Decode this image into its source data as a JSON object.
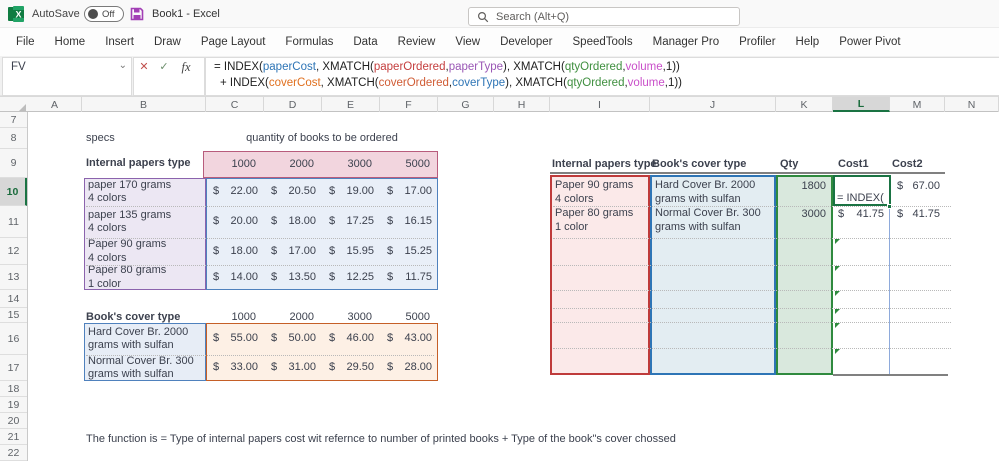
{
  "titlebar": {
    "autosave_label": "AutoSave",
    "autosave_state": "Off",
    "workbook_title": "Book1  -  Excel",
    "search_placeholder": "Search (Alt+Q)"
  },
  "ribbon_tabs": [
    "File",
    "Home",
    "Insert",
    "Draw",
    "Page Layout",
    "Formulas",
    "Data",
    "Review",
    "View",
    "Developer",
    "SpeedTools",
    "Manager Pro",
    "Profiler",
    "Help",
    "Power Pivot"
  ],
  "formula_bar": {
    "name_box": "FV",
    "cancel_label": "✕",
    "enter_label": "✓",
    "fx_label": "fx",
    "line1_segments": [
      {
        "text": "= INDEX(",
        "color": "#1f1f1f"
      },
      {
        "text": "paperCost",
        "color": "#2e75b6"
      },
      {
        "text": ", XMATCH(",
        "color": "#1f1f1f"
      },
      {
        "text": "paperOrdered",
        "color": "#c43e3e"
      },
      {
        "text": ",",
        "color": "#1f1f1f"
      },
      {
        "text": "paperType",
        "color": "#9a57b5"
      },
      {
        "text": "), XMATCH(",
        "color": "#1f1f1f"
      },
      {
        "text": "qtyOrdered",
        "color": "#3f8f3f"
      },
      {
        "text": ",",
        "color": "#1f1f1f"
      },
      {
        "text": "volume",
        "color": "#c94fc9"
      },
      {
        "text": ",1))",
        "color": "#1f1f1f"
      }
    ],
    "line2_segments": [
      {
        "text": "+ INDEX(",
        "color": "#1f1f1f"
      },
      {
        "text": "coverCost",
        "color": "#e0701f"
      },
      {
        "text": ", XMATCH(",
        "color": "#1f1f1f"
      },
      {
        "text": "coverOrdered",
        "color": "#d05c35"
      },
      {
        "text": ",",
        "color": "#1f1f1f"
      },
      {
        "text": "coverType",
        "color": "#2e75b6"
      },
      {
        "text": "), XMATCH(",
        "color": "#1f1f1f"
      },
      {
        "text": "qtyOrdered",
        "color": "#3f8f3f"
      },
      {
        "text": ",",
        "color": "#1f1f1f"
      },
      {
        "text": "volume",
        "color": "#c94fc9"
      },
      {
        "text": ",1))",
        "color": "#1f1f1f"
      }
    ]
  },
  "column_headers": [
    "A",
    "B",
    "C",
    "D",
    "E",
    "F",
    "G",
    "H",
    "I",
    "J",
    "K",
    "L",
    "M",
    "N"
  ],
  "row_headers": [
    "7",
    "8",
    "9",
    "10",
    "11",
    "12",
    "13",
    "14",
    "15",
    "16",
    "17",
    "18",
    "19",
    "20",
    "21",
    "22"
  ],
  "selection": {
    "active_column": "L",
    "active_row": "10"
  },
  "sheet": {
    "currency": "$",
    "specs_label": "specs",
    "qty_banner": "quantity of books to be ordered",
    "paper_table": {
      "header": "Internal papers type",
      "volumes": [
        "1000",
        "2000",
        "3000",
        "5000"
      ],
      "rows": [
        {
          "label_line1": "paper 170 grams",
          "label_line2": "4 colors",
          "costs": [
            "22.00",
            "20.50",
            "19.00",
            "17.00"
          ]
        },
        {
          "label_line1": "paper 135 grams",
          "label_line2": "4 colors",
          "costs": [
            "20.00",
            "18.00",
            "17.25",
            "16.15"
          ]
        },
        {
          "label_line1": "Paper 90 grams",
          "label_line2": "4 colors",
          "costs": [
            "18.00",
            "17.00",
            "15.95",
            "15.25"
          ]
        },
        {
          "label_line1": "Paper 80 grams",
          "label_line2": "1 color",
          "costs": [
            "14.00",
            "13.50",
            "12.25",
            "11.75"
          ]
        }
      ]
    },
    "cover_table": {
      "header": "Book's cover type",
      "volumes": [
        "1000",
        "2000",
        "3000",
        "5000"
      ],
      "rows": [
        {
          "label_line1": "Hard Cover Br. 2000",
          "label_line2": "grams with sulfan",
          "costs": [
            "55.00",
            "50.00",
            "46.00",
            "43.00"
          ]
        },
        {
          "label_line1": "Normal Cover Br. 300",
          "label_line2": "grams with sulfan",
          "costs": [
            "33.00",
            "31.00",
            "29.50",
            "28.00"
          ]
        }
      ]
    },
    "order_table": {
      "headers": [
        "Internal papers type",
        "Book's cover type",
        "Qty",
        "Cost1",
        "Cost2"
      ],
      "editing_text": "= INDEX(",
      "rows": [
        {
          "paper_line1": "Paper 90 grams",
          "paper_line2": "4 colors",
          "cover_line1": "Hard Cover Br. 2000",
          "cover_line2": "grams with sulfan",
          "qty": "1800",
          "cost1": "",
          "cost2": "67.00"
        },
        {
          "paper_line1": "Paper 80 grams",
          "paper_line2": "1 color",
          "cover_line1": "Normal Cover Br. 300",
          "cover_line2": "grams with sulfan",
          "qty": "3000",
          "cost1": "41.75",
          "cost2": "41.75"
        }
      ]
    },
    "note": "The function is = Type of internal papers cost wit refernce to number of printed books  + Type of the book\"s cover chossed"
  },
  "colors": {
    "accent_green": "#1a7343",
    "volume_header_fill": "#f2d5de",
    "volume_header_border": "#b85c7c",
    "paper_label_fill": "#ece7f3",
    "paper_label_border": "#8b63ad",
    "paper_cost_fill": "#e9eff8",
    "paper_cost_border": "#4f81bd",
    "cover_label_fill": "#e7edf6",
    "cover_label_border": "#4f81bd",
    "cover_cost_fill": "#fdf0e5",
    "cover_cost_border": "#c55f27",
    "order_paper_fill": "#fbe9e9",
    "order_paper_border": "#bf3b3b",
    "order_cover_fill": "#e3edf2",
    "order_cover_border": "#2e75b6",
    "order_qty_fill": "#d9e8dd",
    "order_qty_border": "#2f8a3e",
    "order_cost_right_border": "#8eaadb",
    "header_rule": "#808080"
  }
}
